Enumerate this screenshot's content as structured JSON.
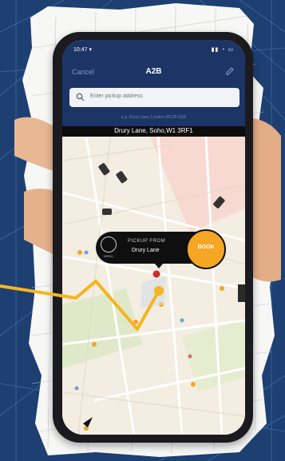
{
  "status_bar": {
    "time": "10:47 ▾",
    "icons": "▮▮ ◔ ▭"
  },
  "navbar": {
    "cancel_label": "Cancel",
    "title": "A2B"
  },
  "search": {
    "placeholder": "Enter pickup address"
  },
  "hint": "e.g. Drury Lane, London WC2B 5QR",
  "location_bar": {
    "text": "Drury Lane, Soho,W1 3RF1"
  },
  "pickup": {
    "label": "PICKUP FROM",
    "location": "Drury Lane",
    "icon_caption": "MENU",
    "book_label": "BOOK"
  },
  "colors": {
    "brand_navy": "#1c3566",
    "accent_orange": "#f5a623",
    "bubble_black": "#0f0f10",
    "map_bg": "#f3ede2"
  },
  "icons": [
    "search-icon",
    "edit-icon",
    "car-icon",
    "compass-icon",
    "pickup-pin-icon"
  ]
}
